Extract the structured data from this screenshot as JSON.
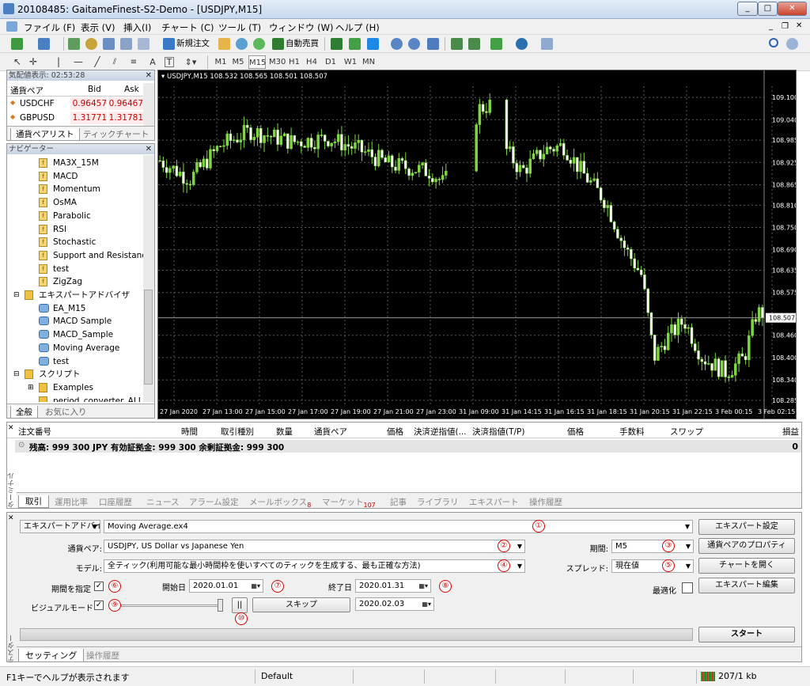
{
  "window": {
    "title": "20108485: GaitameFinest-S2-Demo - [USDJPY,M15]",
    "min": "_",
    "max": "□",
    "close": "✕"
  },
  "menu": [
    "ファイル (F)",
    "表示 (V)",
    "挿入(I)",
    "チャート (C)",
    "ツール (T)",
    "ウィンドウ (W)",
    "ヘルプ (H)"
  ],
  "toolbar": {
    "new_order": "新規注文",
    "auto_trade": "自動売買",
    "timeframes": [
      "M1",
      "M5",
      "M15",
      "M30",
      "H1",
      "H4",
      "D1",
      "W1",
      "MN"
    ]
  },
  "market_watch": {
    "header": "気配値表示: 02:53:28",
    "cols": [
      "通貨ペア",
      "Bid",
      "Ask"
    ],
    "rows": [
      {
        "symbol": "USDCHF",
        "bid": "0.96457",
        "ask": "0.96467"
      },
      {
        "symbol": "GBPUSD",
        "bid": "1.31771",
        "ask": "1.31781"
      }
    ],
    "tabs": [
      "通貨ペアリスト",
      "ティックチャート"
    ]
  },
  "navigator": {
    "header": "ナビゲーター",
    "indicators": [
      "MA3X_15M",
      "MACD",
      "Momentum",
      "OsMA",
      "Parabolic",
      "RSI",
      "Stochastic",
      "Support and Resistance",
      "test",
      "ZigZag"
    ],
    "experts_folder": "エキスパートアドバイザ",
    "experts": [
      "EA_M15",
      "MACD Sample",
      "MACD_Sample",
      "Moving Average",
      "test"
    ],
    "scripts_folder": "スクリプト",
    "scripts": [
      "Examples",
      "period_converter_ALL"
    ],
    "tabs": [
      "全般",
      "お気に入り"
    ]
  },
  "chart": {
    "info": "USDJPY,M15  108.532 108.565 108.501 108.507",
    "prices": [
      "109.100",
      "109.040",
      "108.985",
      "108.925",
      "108.865",
      "108.810",
      "108.750",
      "108.690",
      "108.635",
      "108.575",
      "108.460",
      "108.400",
      "108.340",
      "108.285"
    ],
    "current": "108.507",
    "times": [
      "27 Jan 2020",
      "27 Jan 13:00",
      "27 Jan 15:00",
      "27 Jan 17:00",
      "27 Jan 19:00",
      "27 Jan 21:00",
      "27 Jan 23:00",
      "31 Jan 09:00",
      "31 Jan 14:15",
      "31 Jan 16:15",
      "31 Jan 18:15",
      "31 Jan 20:15",
      "31 Jan 22:15",
      "3 Feb 00:15",
      "3 Feb 02:15"
    ],
    "colors": {
      "bg": "#000000",
      "bull": "#7fd640",
      "bear": "#ffffff",
      "grid": "#5a5a5a"
    }
  },
  "terminal": {
    "cols": [
      "注文番号",
      "時間",
      "取引種別",
      "数量",
      "通貨ペア",
      "価格",
      "決済逆指値(...",
      "決済指値(T/P)",
      "価格",
      "手数料",
      "スワップ",
      "損益"
    ],
    "balance": "残高: 999 300 JPY  有効証拠金: 999 300  余剰証拠金: 999 300",
    "profit": "0",
    "tabs": [
      "取引",
      "運用比率",
      "口座履歴",
      "ニュース",
      "アラーム設定",
      "メールボックス",
      "マーケット",
      "記事",
      "ライブラリ",
      "エキスパート",
      "操作履歴"
    ],
    "mail_count": "8",
    "market_count": "107",
    "side_label": "ターミナル"
  },
  "tester": {
    "type": "エキスパートアドバイザ",
    "ea": "Moving Average.ex4",
    "symbol_label": "通貨ペア:",
    "symbol": "USDJPY, US Dollar vs Japanese Yen",
    "model_label": "モデル:",
    "model": "全ティック(利用可能な最小時間枠を使いすべてのティックを生成する、最も正確な方法)",
    "period_label": "期間:",
    "period": "M5",
    "spread_label": "スプレッド:",
    "spread": "現在値",
    "use_date_label": "期間を指定",
    "from_label": "開始日",
    "from": "2020.01.01",
    "to_label": "終了日",
    "to": "2020.01.31",
    "visual_label": "ビジュアルモード",
    "skip_date": "2020.02.03",
    "skip": "スキップ",
    "pause": "||",
    "optimize_label": "最適化",
    "buttons": {
      "ea_settings": "エキスパート設定",
      "symbol_props": "通貨ペアのプロパティ",
      "open_chart": "チャートを開く",
      "edit_ea": "エキスパート編集",
      "start": "スタート"
    },
    "markers": [
      "①",
      "②",
      "③",
      "④",
      "⑤",
      "⑥",
      "⑦",
      "⑧",
      "⑨",
      "⑩"
    ],
    "tabs": [
      "セッティング",
      "操作履歴"
    ],
    "side_label": "テスター"
  },
  "status": {
    "help": "F1キーでヘルプが表示されます",
    "profile": "Default",
    "traffic": "207/1 kb"
  }
}
